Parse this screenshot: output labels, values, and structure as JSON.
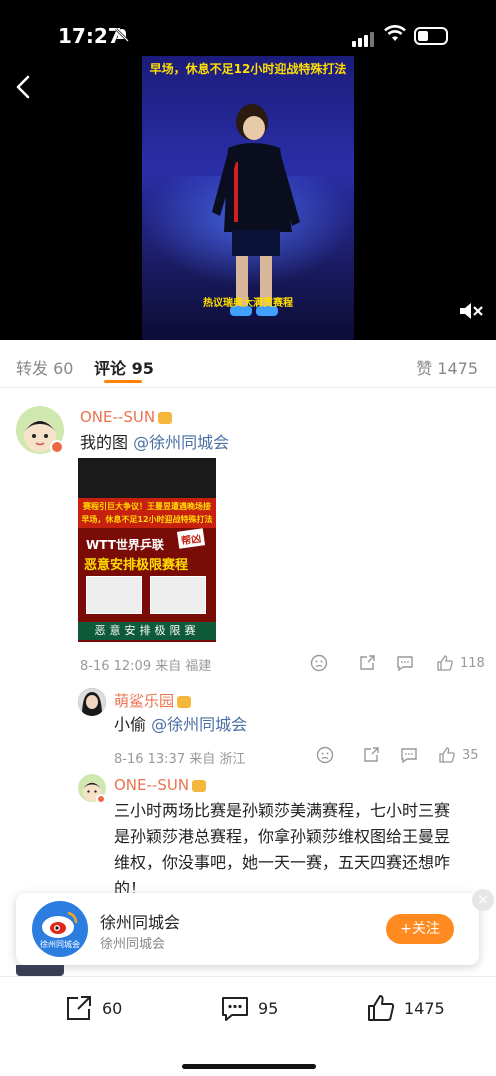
{
  "status_bar": {
    "time": "17:27"
  },
  "video": {
    "caption_top": "早场，休息不足12小时迎战特殊打法",
    "caption_bottom": "热议瑞典大满贯赛程"
  },
  "tabs": {
    "repost": "转发 60",
    "comment": "评论 95",
    "like": "赞 1475"
  },
  "comments": [
    {
      "user": "ONE--SUN",
      "text": "我的图",
      "mention": "@徐州同城会",
      "time": "8-16 12:09",
      "source": "来自 福建",
      "likes": "118",
      "image_lines": {
        "cap1": "赛程引巨大争议！王曼昱遭遇晚场接",
        "cap2": "早场，休息不足12小时迎战特殊打法",
        "title1": "WTT世界乒联",
        "badge": "帮凶",
        "title2": "恶意安排极限赛程",
        "footer": "恶意安排极限赛"
      }
    },
    {
      "user": "萌鲨乐园",
      "text": "小偷",
      "mention": "@徐州同城会",
      "time": "8-16 13:37",
      "source": "来自 浙江",
      "likes": "35"
    },
    {
      "user": "ONE--SUN",
      "text_lines": [
        "三小时两场比赛是孙颖莎美满赛程，七小时三赛",
        "是孙颖莎港总赛程，你拿孙颖莎维权图给王曼昱",
        "维权，你没事吧，她一天一赛，五天四赛还想咋",
        "的！"
      ]
    }
  ],
  "follow_card": {
    "logo_text": "徐州同城会",
    "title": "徐州同城会",
    "subtitle": "徐州同城会",
    "follow_label": "+关注",
    "close": "×"
  },
  "bottom_bar": {
    "repost_count": "60",
    "comment_count": "95",
    "like_count": "1475"
  }
}
